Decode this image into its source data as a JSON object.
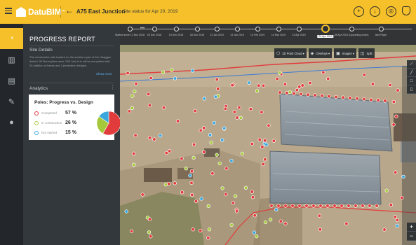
{
  "header": {
    "brand": "DatuBIM",
    "trademark": "™",
    "project_name": "A75 East Junction",
    "subtitle": "Site status for Apr 20, 2019",
    "icons": [
      "plus-circle-icon",
      "download-icon",
      "globe-icon",
      "bell-icon"
    ]
  },
  "rail": {
    "items": [
      {
        "name": "progress-icon",
        "active": true
      },
      {
        "name": "bar-chart-icon",
        "active": false
      },
      {
        "name": "book-icon",
        "active": false
      },
      {
        "name": "edit-icon",
        "active": false
      },
      {
        "name": "droplet-icon",
        "active": false
      }
    ]
  },
  "panel": {
    "title": "PROGRESS REPORT",
    "site_details_heading": "Site Details",
    "site_details_text": "The construction site located on the southern part of the Heaggen district. 90 Bored piles were, 500 Just is in will be completed with 24 addition of bases and 2 pedestrian bridges.",
    "show_more": "Show more",
    "analytics_heading": "Analytics",
    "menu": "⋮"
  },
  "card": {
    "title": "Poles: Progress vs. Design",
    "legend": [
      {
        "label": "Completed",
        "pct": "57 %",
        "color": "#e23b3b"
      },
      {
        "label": "In construction",
        "pct": "26 %",
        "color": "#a5c93a"
      },
      {
        "label": "Not started",
        "pct": "15 %",
        "color": "#3aa7de"
      }
    ]
  },
  "chart_data": {
    "type": "pie",
    "title": "Poles: Progress vs. Design",
    "categories": [
      "Completed",
      "In construction",
      "Not started"
    ],
    "values": [
      57,
      26,
      15
    ],
    "colors": [
      "#e23b3b",
      "#a5c93a",
      "#3aa7de"
    ]
  },
  "timeline": {
    "nodes": [
      {
        "label": "Started since 13 Nov 2018"
      },
      {
        "label": "03 Dec 2018"
      },
      {
        "label": "19 Dec 2018"
      },
      {
        "label": "28 Dec 2018"
      },
      {
        "label": "13 Jan 2019"
      },
      {
        "label": "13 Jan 2019"
      },
      {
        "label": "13 Feb 2019"
      },
      {
        "label": "14 Mar 2019"
      },
      {
        "label": "13 Apr 2019"
      },
      {
        "label": "20 Apr 2019",
        "active": true
      },
      {
        "label": "28 Apr 2019 (Upcoming mode)"
      },
      {
        "label": "Add Flight"
      }
    ],
    "ellipsis": "•••"
  },
  "toolbar": {
    "buttons": [
      {
        "icon": "cube-icon",
        "label": "3D Point Cloud",
        "caret": "▾"
      },
      {
        "icon": "layers-icon",
        "label": "Overlays",
        "caret": "▾"
      },
      {
        "icon": "image-icon",
        "label": "Images",
        "caret": "▾"
      },
      {
        "icon": "split-icon",
        "label": "Split",
        "caret": ""
      }
    ]
  },
  "side_tools": [
    "ruler-icon",
    "line-icon",
    "square-icon",
    "trash-icon"
  ],
  "zoom": {
    "in": "+",
    "out": "−"
  },
  "colors": {
    "accent": "#f5c02a",
    "panel_bg": "#33383d",
    "rail_bg": "#23272b",
    "completed": "#e23b3b",
    "in_construction": "#a5c93a",
    "not_started": "#3aa7de"
  }
}
